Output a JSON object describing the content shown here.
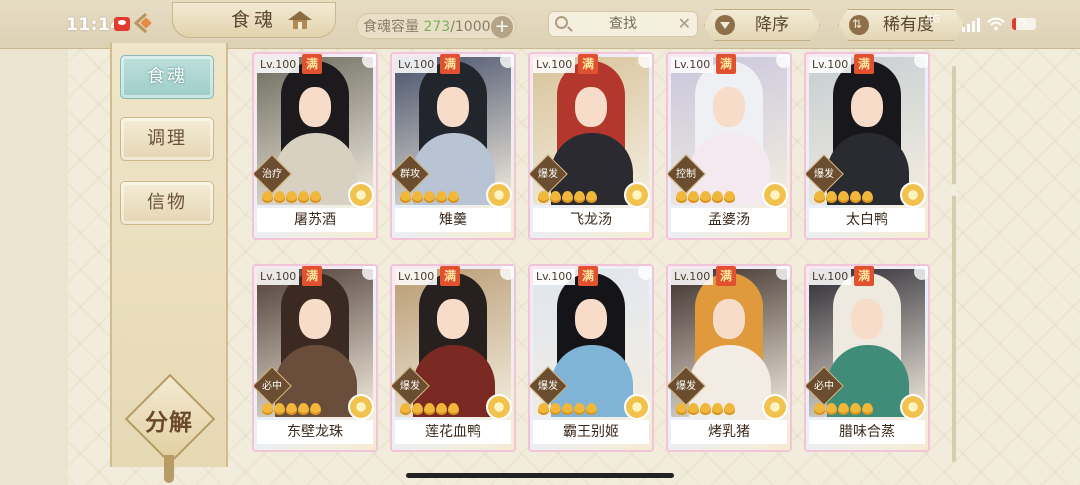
{
  "status_bar": {
    "time": "11:14",
    "network": "4G"
  },
  "header": {
    "title": "食魂",
    "capacity_label": "食魂容量",
    "capacity_current": "273",
    "capacity_max": "/1000",
    "search_label": "查找",
    "sort_label": "降序",
    "rarity_label": "稀有度"
  },
  "sidebar": {
    "tabs": [
      {
        "label": "食魂",
        "active": true
      },
      {
        "label": "调理",
        "active": false
      },
      {
        "label": "信物",
        "active": false
      }
    ],
    "decompose_label": "分解"
  },
  "cards": [
    {
      "level": "Lv.100",
      "max": "满",
      "role": "治疗",
      "stars": 5,
      "name": "屠苏酒",
      "hair": "#1d1a1d",
      "cloth": "#d8d1c2",
      "bg": "#6b6b5e"
    },
    {
      "level": "Lv.100",
      "max": "满",
      "role": "群攻",
      "stars": 5,
      "name": "雉羹",
      "hair": "#22252c",
      "cloth": "#b8c3d4",
      "bg": "#47516a"
    },
    {
      "level": "Lv.100",
      "max": "满",
      "role": "爆发",
      "stars": 5,
      "name": "飞龙汤",
      "hair": "#b3372c",
      "cloth": "#2a2a30",
      "bg": "#d8c49a"
    },
    {
      "level": "Lv.100",
      "max": "满",
      "role": "控制",
      "stars": 5,
      "name": "孟婆汤",
      "hair": "#eef0f4",
      "cloth": "#f4e9ef",
      "bg": "#c9c6dd"
    },
    {
      "level": "Lv.100",
      "max": "满",
      "role": "爆发",
      "stars": 5,
      "name": "太白鸭",
      "hair": "#17171c",
      "cloth": "#2a2b30",
      "bg": "#c6ced2"
    },
    {
      "level": "Lv.100",
      "max": "满",
      "role": "必中",
      "stars": 5,
      "name": "东壁龙珠",
      "hair": "#3a2a22",
      "cloth": "#6a4d3a",
      "bg": "#4f3e36"
    },
    {
      "level": "Lv.100",
      "max": "满",
      "role": "爆发",
      "stars": 5,
      "name": "莲花血鸭",
      "hair": "#26201e",
      "cloth": "#7a2a22",
      "bg": "#b89b72"
    },
    {
      "level": "Lv.100",
      "max": "满",
      "role": "爆发",
      "stars": 5,
      "name": "霸王别姬",
      "hair": "#151418",
      "cloth": "#7fb4d6",
      "bg": "#dfe6f0"
    },
    {
      "level": "Lv.100",
      "max": "满",
      "role": "爆发",
      "stars": 5,
      "name": "烤乳猪",
      "hair": "#e09a3c",
      "cloth": "#f3ece4",
      "bg": "#3c2f2a"
    },
    {
      "level": "Lv.100",
      "max": "满",
      "role": "必中",
      "stars": 5,
      "name": "腊味合蒸",
      "hair": "#eeeae0",
      "cloth": "#3f8c78",
      "bg": "#2c2a33"
    }
  ]
}
